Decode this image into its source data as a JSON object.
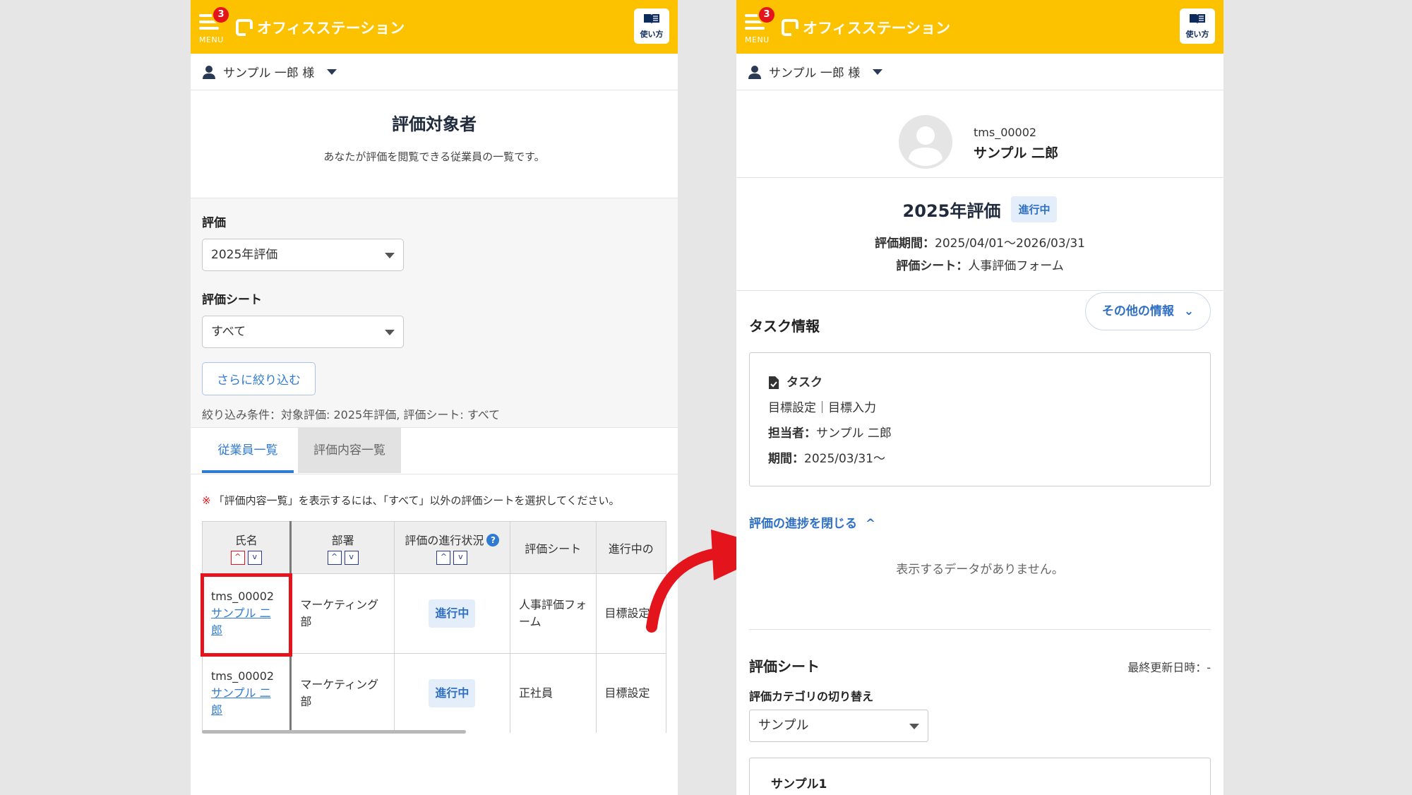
{
  "header": {
    "menu_label": "MENU",
    "badge_count": "3",
    "brand_name": "オフィスステーション",
    "help_label": "使い方"
  },
  "user": {
    "name": "サンプル 一郎 様"
  },
  "list_screen": {
    "title": "評価対象者",
    "description": "あなたが評価を閲覧できる従業員の一覧です。",
    "filters": {
      "eval_label": "評価",
      "eval_value": "2025年評価",
      "sheet_label": "評価シート",
      "sheet_value": "すべて",
      "refine_button": "さらに絞り込む",
      "condition_text": "絞り込み条件：対象評価: 2025年評価, 評価シート: すべて"
    },
    "tabs": [
      "従業員一覧",
      "評価内容一覧"
    ],
    "note_mark": "※",
    "note_text": "「評価内容一覧」を表示するには、「すべて」以外の評価シートを選択してください。",
    "table": {
      "headers": [
        "氏名",
        "部署",
        "評価の進行状況",
        "評価シート",
        "進行中の"
      ],
      "rows": [
        {
          "id": "tms_00002",
          "name": "サンプル 二郎",
          "dept": "マーケティング部",
          "status": "進行中",
          "sheet": "人事評価フォーム",
          "task": "目標設定"
        },
        {
          "id": "tms_00002",
          "name": "サンプル 二郎",
          "dept": "マーケティング部",
          "status": "進行中",
          "sheet": "正社員",
          "task": "目標設定"
        }
      ]
    }
  },
  "detail_screen": {
    "employee_id": "tms_00002",
    "employee_name": "サンプル 二郎",
    "eval_title": "2025年評価",
    "eval_status": "進行中",
    "period_label": "評価期間：",
    "period_value": "2025/04/01～2026/03/31",
    "sheet_label": "評価シート：",
    "sheet_value": "人事評価フォーム",
    "task_section_title": "タスク情報",
    "more_info_button": "その他の情報",
    "task_card": {
      "heading": "タスク",
      "step": "目標設定｜目標入力",
      "assignee_label": "担当者：",
      "assignee_value": "サンプル 二郎",
      "due_label": "期間：",
      "due_value": "2025/03/31～"
    },
    "progress_toggle": "評価の進捗を閉じる",
    "empty_text": "表示するデータがありません。",
    "sheet_section_title": "評価シート",
    "last_updated": "最終更新日時：-",
    "category_label": "評価カテゴリの切り替え",
    "category_value": "サンプル",
    "sample_card_title": "サンプル1"
  },
  "colors": {
    "header": "#fcc200",
    "accent": "#2f7bd1",
    "highlight": "#e3141c"
  }
}
